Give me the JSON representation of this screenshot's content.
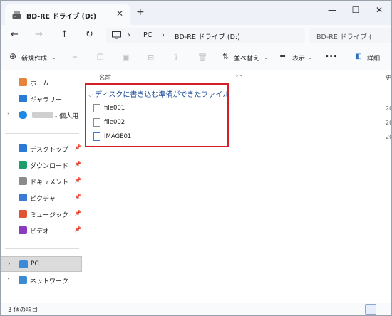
{
  "window": {
    "tab_title": "BD-RE ドライブ (D:)",
    "tab_close": "✕",
    "new_tab": "+",
    "minimize": "—",
    "maximize": "☐",
    "close": "✕"
  },
  "nav": {
    "back": "←",
    "forward": "→",
    "up": "↑",
    "refresh": "↻",
    "breadcrumb": [
      "PC",
      "BD-RE ドライブ (D:)"
    ],
    "breadcrumb_sep": "›",
    "search_placeholder": "BD-RE ドライブ ("
  },
  "commands": {
    "new": "新規作成",
    "sort": "並べ替え",
    "view": "表示",
    "more": "•••",
    "details": "詳細"
  },
  "sidebar": {
    "items": [
      {
        "label": "ホーム",
        "icon": "home-icon",
        "color": "#e8833a"
      },
      {
        "label": "ギャラリー",
        "icon": "gallery-icon",
        "color": "#2a7bd5"
      },
      {
        "label": "- 個人用",
        "icon": "onedrive-icon",
        "color": "#1e88e5"
      },
      {
        "label": "デスクトップ",
        "icon": "desktop-icon",
        "color": "#2a7bd5"
      },
      {
        "label": "ダウンロード",
        "icon": "download-icon",
        "color": "#1e9e6a"
      },
      {
        "label": "ドキュメント",
        "icon": "documents-icon",
        "color": "#8b8b8b"
      },
      {
        "label": "ピクチャ",
        "icon": "pictures-icon",
        "color": "#3a7bd5"
      },
      {
        "label": "ミュージック",
        "icon": "music-icon",
        "color": "#e0552f"
      },
      {
        "label": "ビデオ",
        "icon": "videos-icon",
        "color": "#8a3bc2"
      },
      {
        "label": "PC",
        "icon": "pc-icon",
        "color": "#3a8ad5"
      },
      {
        "label": "ネットワーク",
        "icon": "network-icon",
        "color": "#3a8ad5"
      }
    ]
  },
  "content": {
    "column_name": "名前",
    "column_date_partial": "更",
    "group_title": "ディスクに書き込む準備ができたファイル",
    "files": [
      {
        "name": "file001",
        "date": "20"
      },
      {
        "name": "file002",
        "date": "20"
      },
      {
        "name": "IMAGE01",
        "date": "20"
      }
    ]
  },
  "status": {
    "item_count": "3 個の項目"
  },
  "colors": {
    "accent": "#1f4f9a",
    "highlight_border": "#d21f2a",
    "selection": "#dbdbdb"
  }
}
